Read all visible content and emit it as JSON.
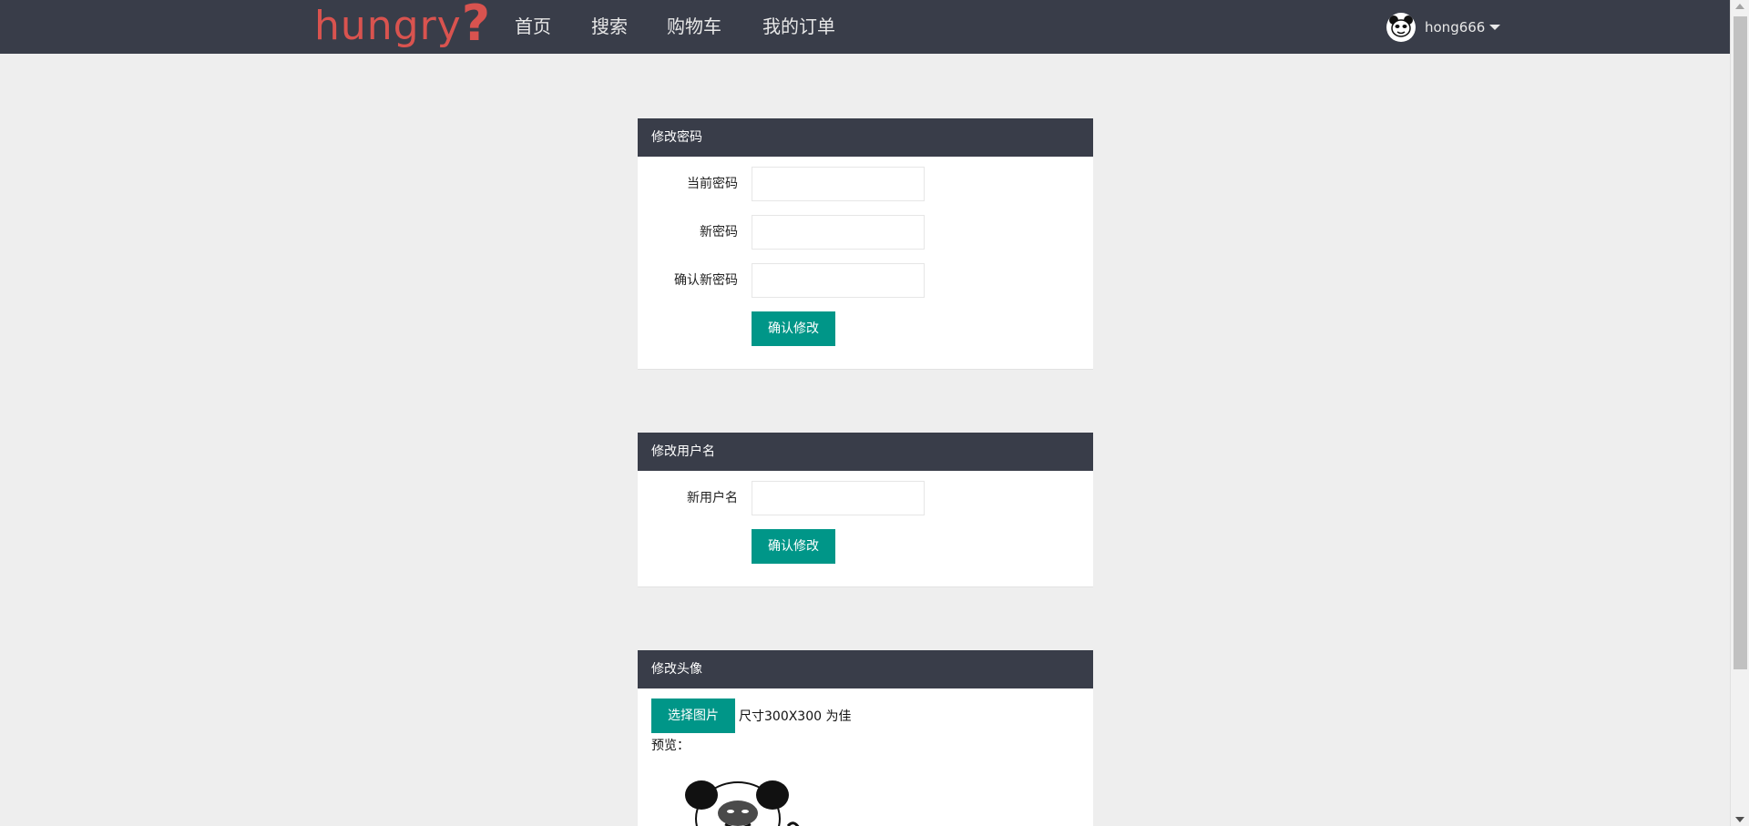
{
  "navbar": {
    "logo": "hungry",
    "logo_mark": "?",
    "items": [
      {
        "label": "首页"
      },
      {
        "label": "搜索"
      },
      {
        "label": "购物车"
      },
      {
        "label": "我的订单"
      }
    ],
    "user": {
      "name": "hong666",
      "avatar_icon": "panda-avatar-icon",
      "caret_icon": "caret-down-icon"
    }
  },
  "password_panel": {
    "title": "修改密码",
    "current_label": "当前密码",
    "new_label": "新密码",
    "confirm_label": "确认新密码",
    "current_value": "",
    "new_value": "",
    "confirm_value": "",
    "submit_label": "确认修改"
  },
  "username_panel": {
    "title": "修改用户名",
    "new_label": "新用户名",
    "new_value": "",
    "submit_label": "确认修改"
  },
  "avatar_panel": {
    "title": "修改头像",
    "choose_label": "选择图片",
    "size_hint": "尺寸300X300 为佳",
    "preview_label": "预览："
  },
  "colors": {
    "nav_bg": "#393d49",
    "accent": "#009688",
    "logo": "#d9534f",
    "page_bg": "#eeeeee"
  }
}
